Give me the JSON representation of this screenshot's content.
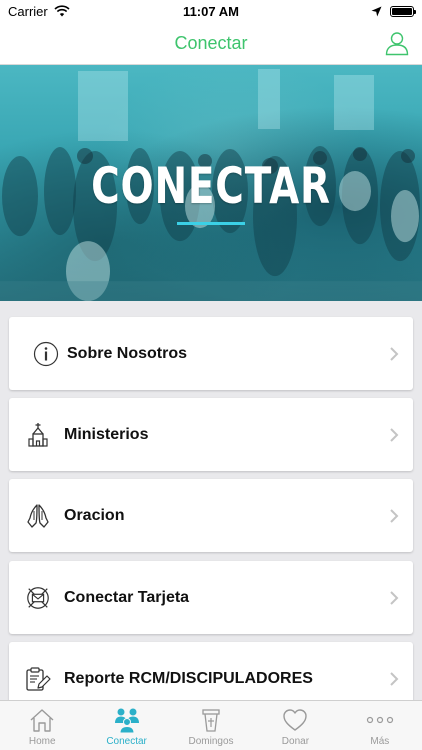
{
  "status_bar": {
    "carrier": "Carrier",
    "time": "11:07 AM"
  },
  "nav": {
    "title": "Conectar",
    "profile_icon": "user-outline-icon"
  },
  "hero": {
    "title": "CONECTAR"
  },
  "menu": {
    "items": [
      {
        "label": "Sobre Nosotros",
        "icon": "info-circle-icon"
      },
      {
        "label": "Ministerios",
        "icon": "church-icon"
      },
      {
        "label": "Oracion",
        "icon": "praying-hands-icon"
      },
      {
        "label": "Conectar Tarjeta",
        "icon": "envelope-circle-icon"
      },
      {
        "label": "Reporte RCM/DISCIPULADORES",
        "icon": "clipboard-edit-icon"
      }
    ]
  },
  "tabs": [
    {
      "label": "Home",
      "icon": "home-icon",
      "active": false
    },
    {
      "label": "Conectar",
      "icon": "people-icon",
      "active": true
    },
    {
      "label": "Domingos",
      "icon": "podium-icon",
      "active": false
    },
    {
      "label": "Donar",
      "icon": "heart-icon",
      "active": false
    },
    {
      "label": "Más",
      "icon": "more-dots-icon",
      "active": false
    }
  ],
  "colors": {
    "accent_green": "#3ec46d",
    "accent_blue": "#2bb0c9",
    "hero_teal": "#3aa7b4"
  }
}
